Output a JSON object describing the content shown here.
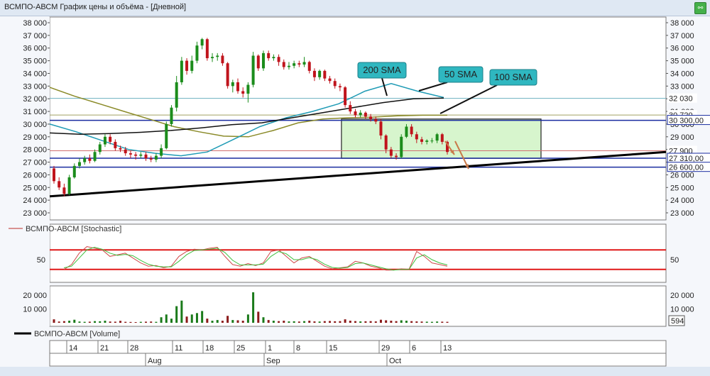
{
  "window": {
    "title": "ВСМПО-АВСМ График цены и объёма - [Дневной]"
  },
  "chart_data": [
    {
      "type": "candlestick",
      "name": "price",
      "ylim": [
        23000,
        38000
      ],
      "yticks": [
        23000,
        24000,
        25000,
        26000,
        27000,
        28000,
        29000,
        30000,
        31000,
        32000,
        33000,
        34000,
        35000,
        36000,
        37000,
        38000
      ],
      "ytick_labels": [
        "23 000",
        "24 000",
        "25 000",
        "26 000",
        "27 000",
        "28 000",
        "29 000",
        "30 000",
        "31 000",
        "32 000",
        "33 000",
        "34 000",
        "35 000",
        "36 000",
        "37 000",
        "38 000"
      ],
      "candles": [
        [
          26500,
          25500,
          26700,
          25300
        ],
        [
          25500,
          25000,
          25800,
          24800
        ],
        [
          25000,
          24500,
          25300,
          24300
        ],
        [
          24500,
          25800,
          26000,
          24400
        ],
        [
          25800,
          26700,
          26900,
          25700
        ],
        [
          26700,
          27000,
          27300,
          26500
        ],
        [
          27000,
          27300,
          27500,
          26800
        ],
        [
          27300,
          27100,
          27600,
          26900
        ],
        [
          27100,
          27800,
          28000,
          27000
        ],
        [
          27800,
          28400,
          28600,
          27600
        ],
        [
          28400,
          29000,
          29200,
          28200
        ],
        [
          29000,
          28600,
          29200,
          28400
        ],
        [
          28600,
          28100,
          28800,
          27900
        ],
        [
          28100,
          28000,
          28300,
          27800
        ],
        [
          28000,
          27700,
          28200,
          27500
        ],
        [
          27700,
          27600,
          27900,
          27300
        ],
        [
          27600,
          27500,
          27800,
          27200
        ],
        [
          27500,
          27600,
          27800,
          27300
        ],
        [
          27600,
          27300,
          27800,
          27100
        ],
        [
          27300,
          27200,
          27500,
          27000
        ],
        [
          27200,
          27500,
          27700,
          27000
        ],
        [
          27500,
          28100,
          28400,
          27300
        ],
        [
          28100,
          30000,
          30200,
          28000
        ],
        [
          30000,
          31300,
          31500,
          29800
        ],
        [
          31300,
          33300,
          33800,
          31000
        ],
        [
          33300,
          35000,
          35300,
          33100
        ],
        [
          35000,
          34200,
          35200,
          33900
        ],
        [
          34200,
          35000,
          35400,
          34000
        ],
        [
          35000,
          36200,
          36500,
          34800
        ],
        [
          36200,
          36700,
          36800,
          35900
        ],
        [
          36700,
          35200,
          36800,
          35000
        ],
        [
          35200,
          35300,
          35600,
          34900
        ],
        [
          35300,
          35400,
          35600,
          35000
        ],
        [
          35400,
          34800,
          35600,
          34600
        ],
        [
          34800,
          33000,
          34900,
          32800
        ],
        [
          33000,
          33300,
          33500,
          32500
        ],
        [
          33300,
          32600,
          33600,
          32400
        ],
        [
          32600,
          32400,
          32900,
          32100
        ],
        [
          32400,
          33100,
          33300,
          31700
        ],
        [
          33100,
          35400,
          35700,
          32900
        ],
        [
          35400,
          34400,
          35500,
          34200
        ],
        [
          34400,
          35600,
          35800,
          34200
        ],
        [
          35600,
          35200,
          35800,
          35000
        ],
        [
          35200,
          35300,
          35500,
          35000
        ],
        [
          35300,
          34900,
          35500,
          34600
        ],
        [
          34900,
          34500,
          35100,
          34300
        ],
        [
          34500,
          34600,
          34900,
          34300
        ],
        [
          34600,
          34800,
          35000,
          34400
        ],
        [
          34800,
          34700,
          35000,
          34500
        ],
        [
          34700,
          34900,
          35300,
          34500
        ],
        [
          34900,
          34200,
          35000,
          34000
        ],
        [
          34200,
          33700,
          34400,
          33400
        ],
        [
          33700,
          34200,
          34300,
          33500
        ],
        [
          34200,
          33600,
          34300,
          33400
        ],
        [
          33600,
          33400,
          33800,
          33200
        ],
        [
          33400,
          33000,
          33600,
          32800
        ],
        [
          33000,
          32900,
          33200,
          32600
        ],
        [
          32900,
          31500,
          33000,
          31300
        ],
        [
          31500,
          31000,
          31800,
          30800
        ],
        [
          31000,
          30700,
          31200,
          30500
        ],
        [
          30700,
          30900,
          31100,
          30500
        ],
        [
          30900,
          30600,
          31000,
          30400
        ],
        [
          30600,
          30400,
          30800,
          30200
        ],
        [
          30400,
          30200,
          30600,
          30000
        ],
        [
          30200,
          29100,
          30400,
          28800
        ],
        [
          29100,
          28000,
          29200,
          27700
        ],
        [
          28000,
          27500,
          28200,
          27300
        ],
        [
          27500,
          27400,
          27700,
          27200
        ],
        [
          27400,
          29000,
          29200,
          27300
        ],
        [
          29000,
          29800,
          30000,
          28900
        ],
        [
          29800,
          29200,
          30000,
          29000
        ],
        [
          29200,
          28800,
          29400,
          28500
        ],
        [
          28800,
          28600,
          29000,
          28400
        ],
        [
          28600,
          28700,
          28800,
          28400
        ],
        [
          28700,
          28700,
          28900,
          28500
        ],
        [
          28700,
          29200,
          29300,
          28500
        ],
        [
          29200,
          28600,
          29300,
          28400
        ],
        [
          28600,
          27800,
          28700,
          27600
        ]
      ],
      "moving_averages": [
        {
          "name": "200 SMA",
          "color": "#8a8a28",
          "values": [
            32900,
            32200,
            31600,
            31000,
            30400,
            29800,
            29400,
            29050,
            29000,
            29500,
            30100,
            30400,
            30500,
            30550,
            30650,
            30700,
            30700
          ]
        },
        {
          "name": "50 SMA",
          "color": "#1f9bb5",
          "values": [
            30000,
            29400,
            28700,
            28000,
            27700,
            27500,
            27800,
            28800,
            29800,
            30500,
            31000,
            31600,
            32600,
            33200,
            32600,
            32100
          ]
        },
        {
          "name": "100 SMA",
          "color": "#111111",
          "values": [
            29300,
            29200,
            29250,
            29350,
            29500,
            29700,
            29950,
            30100,
            30500,
            30900,
            31300,
            31700,
            32000,
            32050
          ]
        }
      ],
      "trendline": {
        "from": 24300,
        "to": 27800
      },
      "horizontal_levels": [
        {
          "value": 32030,
          "label": "32 030",
          "color": "#6cb0c0"
        },
        {
          "value": 30720,
          "label": "30 720",
          "color": "#a0a060"
        },
        {
          "value": 30300,
          "label": "30 300,00",
          "color": "#1a2da0"
        },
        {
          "value": 27900,
          "label": "27 900",
          "color": "#d07070"
        },
        {
          "value": 27310,
          "label": "27 310,00",
          "color": "#1a2da0"
        },
        {
          "value": 26600,
          "label": "26 600,00",
          "color": "#1a2da0"
        }
      ],
      "range_box": {
        "top": 30400,
        "bottom": 27300
      }
    },
    {
      "type": "line",
      "name": "stochastic",
      "legend": "ВСМПО-АВСМ [Stochastic]",
      "ytick_labels": [
        "50"
      ],
      "levels": [
        80,
        20
      ],
      "k": [
        20,
        35,
        70,
        90,
        85,
        80,
        60,
        65,
        70,
        55,
        40,
        30,
        32,
        25,
        30,
        60,
        75,
        82,
        80,
        85,
        88,
        60,
        35,
        30,
        38,
        32,
        40,
        75,
        80,
        60,
        40,
        55,
        60,
        45,
        30,
        22,
        25,
        28,
        45,
        40,
        30,
        25,
        18,
        18,
        22,
        20,
        75,
        60,
        40,
        35,
        30
      ],
      "d": [
        25,
        30,
        55,
        80,
        88,
        82,
        70,
        63,
        66,
        62,
        48,
        36,
        30,
        28,
        28,
        45,
        65,
        78,
        80,
        82,
        85,
        72,
        48,
        34,
        34,
        34,
        36,
        60,
        75,
        68,
        50,
        50,
        56,
        50,
        36,
        26,
        24,
        26,
        38,
        40,
        34,
        28,
        22,
        18,
        20,
        20,
        55,
        65,
        50,
        40,
        34
      ]
    },
    {
      "type": "bar",
      "name": "volume",
      "legend": "ВСМПО-АВСМ [Volume]",
      "yticks": [
        10000,
        20000
      ],
      "ytick_labels": [
        "10 000",
        "20 000"
      ],
      "last_value": "594",
      "values": [
        [
          2500,
          "#8b1a1a"
        ],
        [
          900,
          "#8b1a1a"
        ],
        [
          1200,
          "#8b1a1a"
        ],
        [
          1500,
          "#1a7a1a"
        ],
        [
          2200,
          "#1a7a1a"
        ],
        [
          900,
          "#1a7a1a"
        ],
        [
          700,
          "#1a7a1a"
        ],
        [
          800,
          "#8b1a1a"
        ],
        [
          1200,
          "#1a7a1a"
        ],
        [
          1100,
          "#1a7a1a"
        ],
        [
          1500,
          "#1a7a1a"
        ],
        [
          900,
          "#8b1a1a"
        ],
        [
          800,
          "#8b1a1a"
        ],
        [
          1400,
          "#8b1a1a"
        ],
        [
          700,
          "#8b1a1a"
        ],
        [
          600,
          "#8b1a1a"
        ],
        [
          500,
          "#8b1a1a"
        ],
        [
          700,
          "#1a7a1a"
        ],
        [
          800,
          "#8b1a1a"
        ],
        [
          900,
          "#8b1a1a"
        ],
        [
          700,
          "#1a7a1a"
        ],
        [
          4000,
          "#1a7a1a"
        ],
        [
          6000,
          "#1a7a1a"
        ],
        [
          3000,
          "#1a7a1a"
        ],
        [
          12000,
          "#1a7a1a"
        ],
        [
          16000,
          "#1a7a1a"
        ],
        [
          4500,
          "#8b1a1a"
        ],
        [
          6000,
          "#1a7a1a"
        ],
        [
          7000,
          "#1a7a1a"
        ],
        [
          8500,
          "#1a7a1a"
        ],
        [
          3000,
          "#8b1a1a"
        ],
        [
          1500,
          "#1a7a1a"
        ],
        [
          2000,
          "#1a7a1a"
        ],
        [
          1500,
          "#8b1a1a"
        ],
        [
          5000,
          "#8b1a1a"
        ],
        [
          2000,
          "#1a7a1a"
        ],
        [
          1800,
          "#8b1a1a"
        ],
        [
          1500,
          "#8b1a1a"
        ],
        [
          6000,
          "#1a7a1a"
        ],
        [
          22000,
          "#1a7a1a"
        ],
        [
          8000,
          "#8b1a1a"
        ],
        [
          4000,
          "#1a7a1a"
        ],
        [
          2000,
          "#8b1a1a"
        ],
        [
          1500,
          "#1a7a1a"
        ],
        [
          1200,
          "#8b1a1a"
        ],
        [
          1500,
          "#8b1a1a"
        ],
        [
          1000,
          "#1a7a1a"
        ],
        [
          1100,
          "#1a7a1a"
        ],
        [
          900,
          "#8b1a1a"
        ],
        [
          1200,
          "#1a7a1a"
        ],
        [
          1500,
          "#8b1a1a"
        ],
        [
          1000,
          "#8b1a1a"
        ],
        [
          900,
          "#1a7a1a"
        ],
        [
          1200,
          "#8b1a1a"
        ],
        [
          1300,
          "#8b1a1a"
        ],
        [
          1100,
          "#8b1a1a"
        ],
        [
          1200,
          "#8b1a1a"
        ],
        [
          2500,
          "#8b1a1a"
        ],
        [
          1500,
          "#8b1a1a"
        ],
        [
          1200,
          "#8b1a1a"
        ],
        [
          1000,
          "#1a7a1a"
        ],
        [
          1100,
          "#8b1a1a"
        ],
        [
          1200,
          "#8b1a1a"
        ],
        [
          1000,
          "#8b1a1a"
        ],
        [
          2200,
          "#8b1a1a"
        ],
        [
          1800,
          "#8b1a1a"
        ],
        [
          1500,
          "#8b1a1a"
        ],
        [
          1200,
          "#8b1a1a"
        ],
        [
          1800,
          "#1a7a1a"
        ],
        [
          1500,
          "#1a7a1a"
        ],
        [
          1200,
          "#8b1a1a"
        ],
        [
          1000,
          "#8b1a1a"
        ],
        [
          900,
          "#8b1a1a"
        ],
        [
          800,
          "#1a7a1a"
        ],
        [
          700,
          "#1a7a1a"
        ],
        [
          900,
          "#1a7a1a"
        ],
        [
          800,
          "#8b1a1a"
        ],
        [
          700,
          "#8b1a1a"
        ]
      ]
    }
  ],
  "x_axis": {
    "day_labels": [
      "14",
      "21",
      "28",
      "11",
      "18",
      "25",
      "1",
      "8",
      "15",
      "29",
      "6",
      "13"
    ],
    "month_labels": [
      "Aug",
      "Sep",
      "Oct"
    ]
  }
}
